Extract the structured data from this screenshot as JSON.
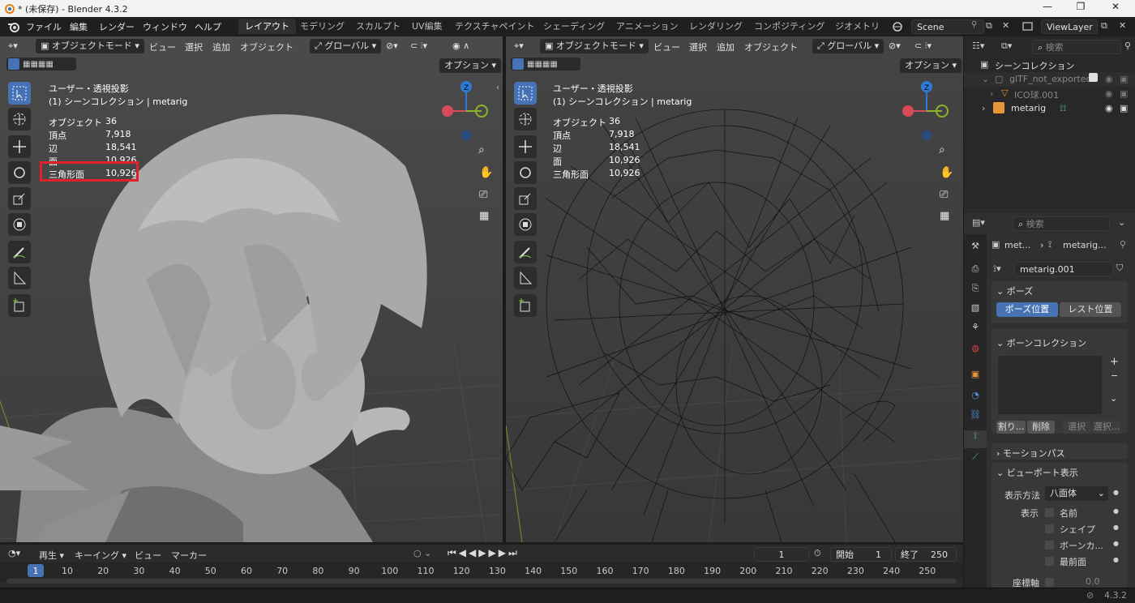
{
  "window": {
    "title": "* (未保存) - Blender 4.3.2"
  },
  "menu": [
    "ファイル",
    "編集",
    "レンダー",
    "ウィンドウ",
    "ヘルプ"
  ],
  "workspaces": [
    {
      "label": "レイアウト",
      "active": true
    },
    {
      "label": "モデリング"
    },
    {
      "label": "スカルプト"
    },
    {
      "label": "UV編集"
    },
    {
      "label": "テクスチャペイント"
    },
    {
      "label": "シェーディング"
    },
    {
      "label": "アニメーション"
    },
    {
      "label": "レンダリング"
    },
    {
      "label": "コンポジティング"
    },
    {
      "label": "ジオメトリ"
    }
  ],
  "scene": {
    "name": "Scene"
  },
  "view_layer": {
    "name": "ViewLayer"
  },
  "viewport_left": {
    "mode": "オブジェクトモード",
    "menus": [
      "ビュー",
      "選択",
      "追加",
      "オブジェクト"
    ],
    "transform": "グローバル",
    "options": "オプション",
    "view_name": "ユーザー・透視投影",
    "collection": "(1) シーンコレクション | metarig",
    "stats": [
      {
        "label": "オブジェクト",
        "value": "36"
      },
      {
        "label": "頂点",
        "value": "7,918"
      },
      {
        "label": "辺",
        "value": "18,541"
      },
      {
        "label": "面",
        "value": "10,926"
      },
      {
        "label": "三角形面",
        "value": "10,926"
      }
    ],
    "highlight_color": "#e0202a"
  },
  "viewport_right": {
    "mode": "オブジェクトモード",
    "menus": [
      "ビュー",
      "選択",
      "追加",
      "オブジェクト"
    ],
    "transform": "グローバル",
    "options": "オプション",
    "view_name": "ユーザー・透視投影",
    "collection": "(1) シーンコレクション | metarig",
    "stats": [
      {
        "label": "オブジェクト",
        "value": "36"
      },
      {
        "label": "頂点",
        "value": "7,918"
      },
      {
        "label": "辺",
        "value": "18,541"
      },
      {
        "label": "面",
        "value": "10,926"
      },
      {
        "label": "三角形面",
        "value": "10,926"
      }
    ]
  },
  "gizmo": {
    "z": "Z"
  },
  "outliner": {
    "search_placeholder": "検索",
    "root": "シーンコレクション",
    "items": [
      {
        "label": "glTF_not_exported"
      },
      {
        "label": "ICO球.001"
      },
      {
        "label": "metarig"
      }
    ]
  },
  "properties": {
    "search_placeholder": "検索",
    "breadcrumb_a": "met...",
    "breadcrumb_b": "metarig...",
    "armature_name": "metarig.001",
    "pose_header": "ポーズ",
    "pose_position": "ポーズ位置",
    "rest_position": "レスト位置",
    "bone_collection_header": "ボーンコレクション",
    "assign": "割り...",
    "remove": "削除",
    "select": "選択",
    "deselect": "選択...",
    "motion_paths": "モーションパス",
    "viewport_display": "ビューポート表示",
    "display_as_label": "表示方法",
    "display_as_value": "八面体",
    "show_label": "表示",
    "show_names": "名前",
    "show_shapes": "シェイプ",
    "show_bone_colors": "ボーンカ...",
    "show_in_front": "最前面",
    "axes_label": "座標軸",
    "axes_value": "0.0"
  },
  "timeline": {
    "menus": [
      "再生",
      "キーイング",
      "ビュー",
      "マーカー"
    ],
    "current_frame": "1",
    "start_label": "開始",
    "start": "1",
    "end_label": "終了",
    "end": "250",
    "ticks": [
      "1",
      "10",
      "20",
      "30",
      "40",
      "50",
      "60",
      "70",
      "80",
      "90",
      "100",
      "110",
      "120",
      "130",
      "140",
      "150",
      "160",
      "170",
      "180",
      "190",
      "200",
      "210",
      "220",
      "230",
      "240",
      "250"
    ]
  },
  "status": {
    "version": "4.3.2"
  }
}
